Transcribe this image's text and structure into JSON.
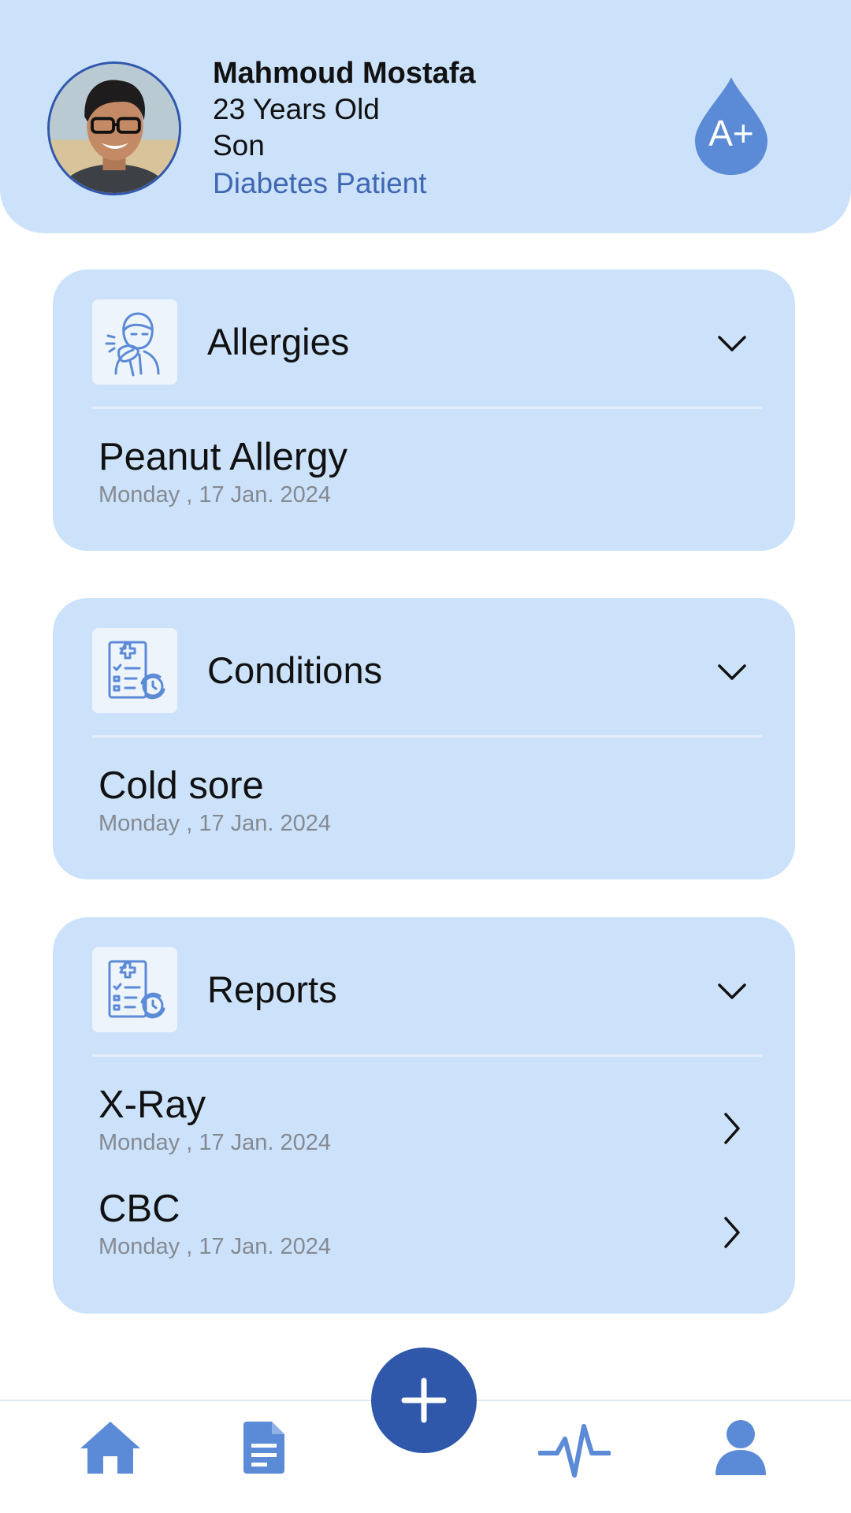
{
  "profile": {
    "name": "Mahmoud Mostafa",
    "age": "23 Years Old",
    "relation": "Son",
    "status": "Diabetes Patient",
    "blood_type": "A+"
  },
  "cards": [
    {
      "title": "Allergies",
      "icon": "sneezing-person-icon",
      "entries": [
        {
          "title": "Peanut Allergy",
          "date": "Monday , 17 Jan. 2024"
        }
      ]
    },
    {
      "title": "Conditions",
      "icon": "medical-report-clock-icon",
      "entries": [
        {
          "title": "Cold sore",
          "date": "Monday , 17 Jan. 2024"
        }
      ]
    },
    {
      "title": "Reports",
      "icon": "medical-report-clock-icon",
      "entries": [
        {
          "title": "X-Ray",
          "date": "Monday , 17 Jan. 2024"
        },
        {
          "title": "CBC",
          "date": "Monday , 17 Jan. 2024"
        }
      ]
    }
  ],
  "nav": {
    "items": [
      "home-icon",
      "document-icon",
      "add-icon",
      "activity-pulse-icon",
      "profile-icon"
    ],
    "active": "home-icon"
  },
  "colors": {
    "card_background": "#cce2fb",
    "accent_dark": "#2f58ab",
    "accent_icon": "#5b8ad6",
    "status_text": "#3f67b4",
    "date_text": "#858a92"
  }
}
